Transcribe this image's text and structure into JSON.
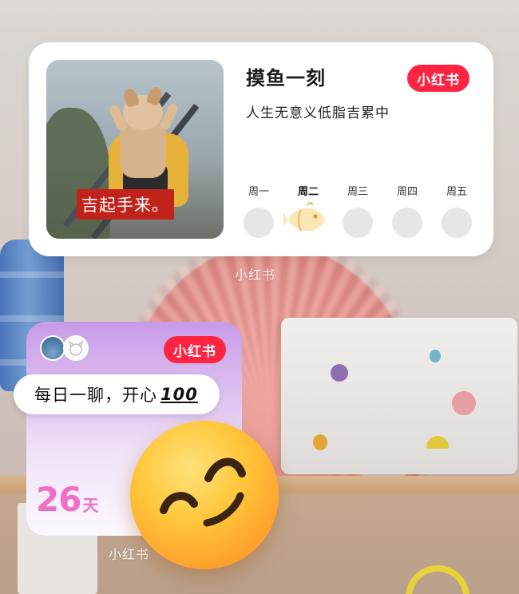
{
  "widget1": {
    "title": "摸鱼一刻",
    "subtitle": "人生无意义低脂吉累中",
    "brand": "小红书",
    "photo_caption": "吉起手来。",
    "days": [
      "周一",
      "周二",
      "周三",
      "周四",
      "周五"
    ],
    "active_day_index": 1,
    "app_label": "小红书"
  },
  "widget2": {
    "brand": "小红书",
    "message": "每日一聊，开心",
    "message_emoji": "100",
    "count_number": "26",
    "count_unit": "天",
    "app_label": "小红书"
  },
  "colors": {
    "brand_red": "#ff2442",
    "count_pink": "#f06ec8",
    "caption_red": "#c1231b"
  },
  "icons": {
    "fish": "fish-icon",
    "emoji": "smiling-face-emoji"
  }
}
